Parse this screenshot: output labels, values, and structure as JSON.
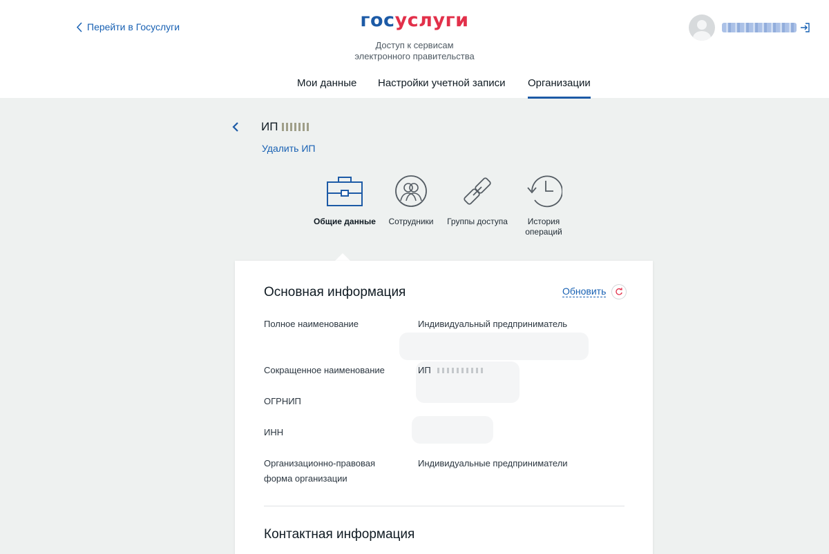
{
  "header": {
    "back_link": "Перейти в Госуслуги",
    "logo_part1": "гос",
    "logo_part2": "услуги",
    "subtitle_line1": "Доступ к сервисам",
    "subtitle_line2": "электронного правительства"
  },
  "nav": {
    "items": [
      {
        "label": "Мои данные"
      },
      {
        "label": "Настройки учетной записи"
      },
      {
        "label": "Организации"
      }
    ],
    "active_index": 2
  },
  "organization": {
    "title_prefix": "ИП",
    "delete_label": "Удалить ИП"
  },
  "tabs": [
    {
      "label": "Общие данные",
      "icon": "briefcase-icon",
      "active": true
    },
    {
      "label": "Сотрудники",
      "icon": "employees-icon",
      "active": false
    },
    {
      "label": "Группы доступа",
      "icon": "link-icon",
      "active": false
    },
    {
      "label": "История операций",
      "icon": "history-icon",
      "active": false
    }
  ],
  "main_info": {
    "title": "Основная информация",
    "refresh_label": "Обновить",
    "rows": [
      {
        "label": "Полное наименование",
        "value": "Индивидуальный предприниматель"
      },
      {
        "label": "Сокращенное наименование",
        "value": "ИП"
      },
      {
        "label": "ОГРНИП",
        "value": ""
      },
      {
        "label": "ИНН",
        "value": ""
      },
      {
        "label": "Организационно-правовая форма организации",
        "value": "Индивидуальные предприниматели"
      }
    ]
  },
  "contact_info": {
    "title": "Контактная информация"
  },
  "colors": {
    "accent": "#1c5aa6",
    "brand_red": "#e2304a",
    "link": "#1760b3",
    "background": "#eef1f0"
  }
}
